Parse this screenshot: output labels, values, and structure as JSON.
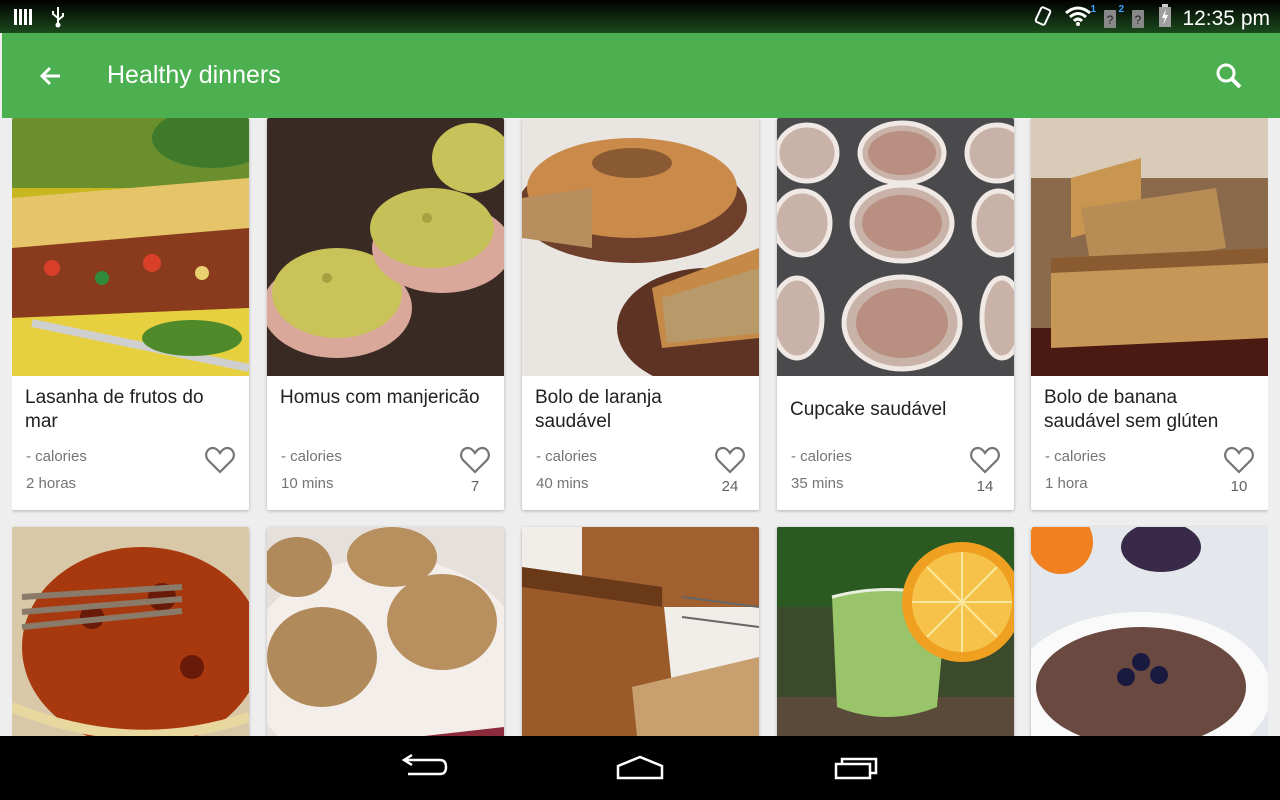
{
  "status_bar": {
    "time": "12:35 pm",
    "icons": [
      "signal-bars-icon",
      "usb-icon",
      "vibrate-icon",
      "wifi-icon",
      "sim-1-icon",
      "sim-2-icon",
      "battery-charging-icon"
    ],
    "sim1_label": "1",
    "sim2_label": "2"
  },
  "app_bar": {
    "title": "Healthy dinners",
    "color": "#4caf50"
  },
  "recipes": [
    {
      "name": "Lasanha de frutos do mar",
      "calories": "- calories",
      "time": "2 horas",
      "likes": ""
    },
    {
      "name": "Homus com manjericão",
      "calories": "- calories",
      "time": "10 mins",
      "likes": "7"
    },
    {
      "name": "Bolo de laranja saudável",
      "calories": "- calories",
      "time": "40 mins",
      "likes": "24"
    },
    {
      "name": "Cupcake saudável",
      "calories": "- calories",
      "time": "35 mins",
      "likes": "14"
    },
    {
      "name": "Bolo de banana saudável sem glúten",
      "calories": "- calories",
      "time": "1 hora",
      "likes": "10"
    }
  ],
  "second_row_images": [
    "spaghetti-bolognese-image",
    "muffins-image",
    "banana-bread-image",
    "green-smoothie-image",
    "pancake-image"
  ],
  "nav_bar": {
    "buttons": [
      "back-nav-icon",
      "home-nav-icon",
      "recents-nav-icon"
    ]
  }
}
